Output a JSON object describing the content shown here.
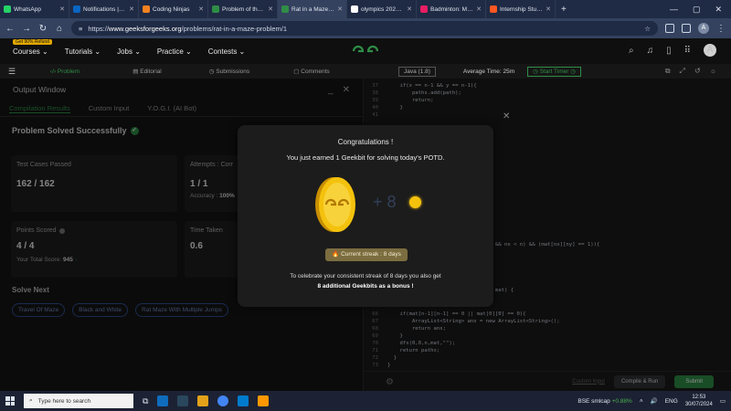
{
  "browser": {
    "tabs": [
      {
        "label": "WhatsApp",
        "color": "#25d366",
        "active": false
      },
      {
        "label": "Notifications | Lin",
        "color": "#0a66c2",
        "active": false
      },
      {
        "label": "Coding Ninjas",
        "color": "#f58220",
        "active": false
      },
      {
        "label": "Problem of the Da",
        "color": "#2f8d46",
        "active": false
      },
      {
        "label": "Rat in a Maze Prol",
        "color": "#2f8d46",
        "active": true
      },
      {
        "label": "olympics 2024 sch",
        "color": "#ffffff",
        "active": false
      },
      {
        "label": "Badminton: Men's",
        "color": "#e91e63",
        "active": false
      },
      {
        "label": "Internship Studio",
        "color": "#ff5722",
        "active": false
      }
    ],
    "url_host": "www.geeksforgeeks.org",
    "url_path": "/problems/rat-in-a-maze-problem/1",
    "url_scheme": "https://",
    "profile_letter": "A"
  },
  "gfg": {
    "badge": "Get 90% Refund",
    "menus": [
      "Courses",
      "Tutorials",
      "Jobs",
      "Practice",
      "Contests"
    ],
    "avatar_letter": "A"
  },
  "problem_tabs": [
    "Problem",
    "Editorial",
    "Submissions",
    "Comments"
  ],
  "editor_bar": {
    "language": "Java (1.8)",
    "avg_time": "Average Time: 25m",
    "timer": "Start Timer"
  },
  "output": {
    "title": "Output Window",
    "tabs": [
      "Compilation Results",
      "Custom Input",
      "Y.O.G.I. (AI Bot)"
    ],
    "status": "Problem Solved Successfully",
    "test_cases_label": "Test Cases Passed",
    "test_cases_value": "162 / 162",
    "attempts_label": "Attempts : Corr",
    "attempts_value": "1 / 1",
    "accuracy_label": "Accuracy :",
    "accuracy_value": "100%",
    "points_label": "Points Scored",
    "points_value": "4 / 4",
    "total_score_label": "Your Total Score:",
    "total_score_value": "945",
    "time_label": "Time Taken",
    "time_value": "0.6",
    "solve_next": "Solve Next",
    "next_problems": [
      "Travel Of Maze",
      "Black and White",
      "Rat Maze With Multiple Jumps"
    ]
  },
  "code": [
    {
      "n": "37",
      "t": "    if(x == n-1 && y == n-1){"
    },
    {
      "n": "38",
      "t": "        paths.add(path);"
    },
    {
      "n": "39",
      "t": "        return;"
    },
    {
      "n": "40",
      "t": "    }"
    },
    {
      "n": "41",
      "t": ""
    },
    {
      "n": "",
      "t": "                  \"L\",\"U\",\"D\"};"
    },
    {
      "n": "",
      "t": "                  },{1,0}"
    },
    {
      "n": "",
      "t": "                  ].length;i++){"
    },
    {
      "n": "",
      "t": "                  rs[i];"
    },
    {
      "n": "",
      "t": "                  ];"
    },
    {
      "n": "",
      "t": "                  ];"
    },
    {
      "n": "",
      "t": "                  < n) && (0 <= nx && nx < n) && (mat[nx][ny] == 1)){"
    },
    {
      "n": "",
      "t": "                  at,path+move);"
    },
    {
      "n": "",
      "t": "                  FindPath(int[][] mat) {"
    },
    {
      "n": "66",
      "t": "    if(mat[n-1][n-1] == 0 || mat[0][0] == 0){"
    },
    {
      "n": "67",
      "t": "        ArrayList<String> ans = new ArrayList<String>();"
    },
    {
      "n": "68",
      "t": "        return ans;"
    },
    {
      "n": "69",
      "t": "    }"
    },
    {
      "n": "70",
      "t": "    dfs(0,0,n,mat,\"\");"
    },
    {
      "n": "71",
      "t": "    return paths;"
    },
    {
      "n": "72",
      "t": "  }"
    },
    {
      "n": "73",
      "t": "}"
    }
  ],
  "actions": {
    "custom_input": "Custom Input",
    "compile_run": "Compile & Run",
    "submit": "Submit"
  },
  "modal": {
    "title": "Congratulations !",
    "subtitle": "You just earned 1 Geekbit for solving today's POTD.",
    "bonus_number": "+ 8",
    "streak": "Current streak : 8 days",
    "desc_line1": "To celebrate your consistent streak of 8 days you also get",
    "desc_line2": "8 additional Geekbits as a bonus !"
  },
  "taskbar": {
    "search_placeholder": "Type here to search",
    "stock_name": "BSE smlcap",
    "stock_change": "+0.88%",
    "lang": "ENG",
    "time": "12:53",
    "date": "30/07/2024"
  },
  "colors": {
    "accent": "#2f8d46",
    "coin": "#f4c20d"
  }
}
